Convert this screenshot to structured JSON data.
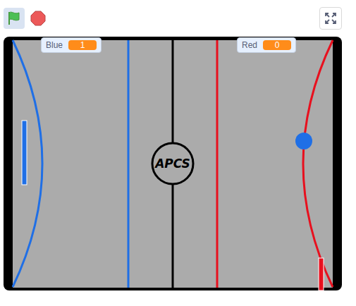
{
  "toolbar": {
    "green_flag_selected": true
  },
  "monitors": [
    {
      "label": "Blue",
      "value": "1"
    },
    {
      "label": "Red",
      "value": "0"
    }
  ],
  "stage": {
    "logo": "APCS"
  },
  "paddles": [
    {
      "color": "#1f6fe6"
    },
    {
      "color": "#e8101e"
    }
  ]
}
